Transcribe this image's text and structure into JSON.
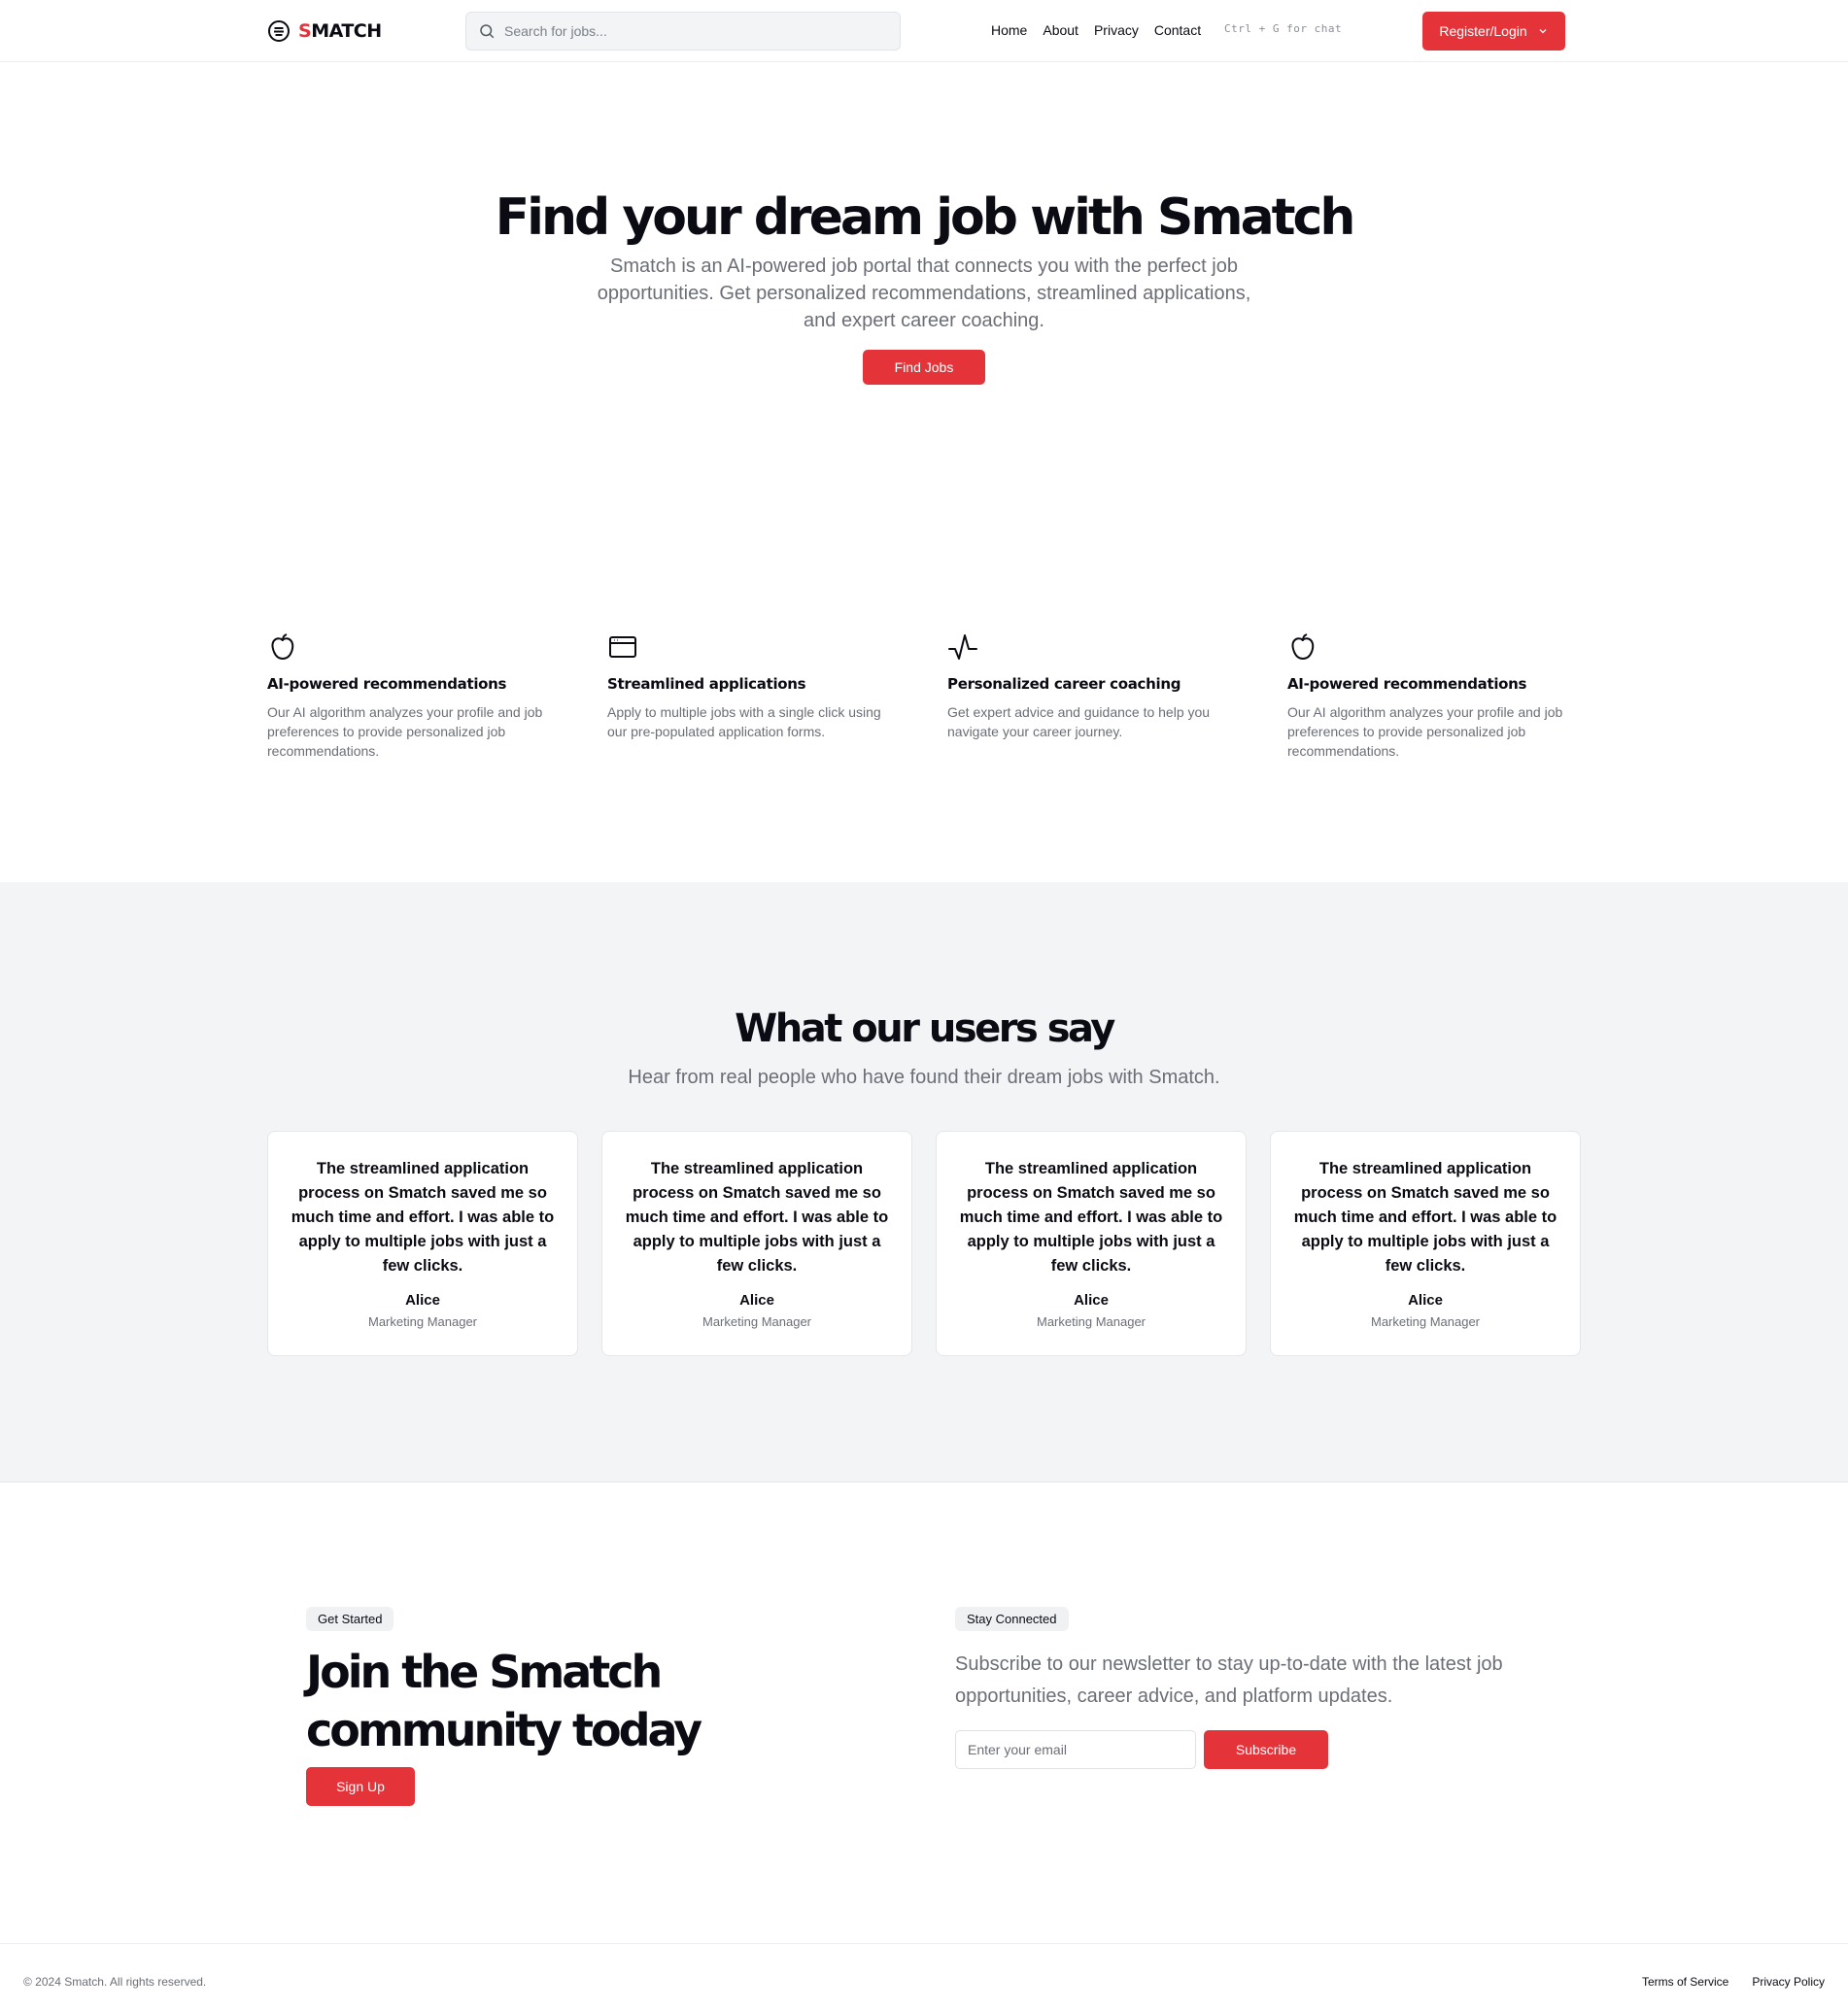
{
  "brand": {
    "first_letter": "S",
    "rest": "MATCH"
  },
  "search": {
    "placeholder": "Search for jobs..."
  },
  "nav": {
    "items": [
      "Home",
      "About",
      "Privacy",
      "Contact"
    ]
  },
  "chat_hint": "Ctrl + G for chat",
  "auth": {
    "label": "Register/Login"
  },
  "hero": {
    "title": "Find your dream job with Smatch",
    "subtitle": "Smatch is an AI-powered job portal that connects you with the perfect job opportunities. Get personalized recommendations, streamlined applications, and expert career coaching.",
    "cta": "Find Jobs"
  },
  "features": [
    {
      "icon": "apple-icon",
      "title": "AI-powered recommendations",
      "text": "Our AI algorithm analyzes your profile and job preferences to provide personalized job recommendations."
    },
    {
      "icon": "window-icon",
      "title": "Streamlined applications",
      "text": "Apply to multiple jobs with a single click using our pre-populated application forms."
    },
    {
      "icon": "activity-icon",
      "title": "Personalized career coaching",
      "text": "Get expert advice and guidance to help you navigate your career journey."
    },
    {
      "icon": "apple-icon",
      "title": "AI-powered recommendations",
      "text": "Our AI algorithm analyzes your profile and job preferences to provide personalized job recommendations."
    }
  ],
  "testimonials": {
    "title": "What our users say",
    "subtitle": "Hear from real people who have found their dream jobs with Smatch.",
    "items": [
      {
        "quote": "The streamlined application process on Smatch saved me so much time and effort. I was able to apply to multiple jobs with just a few clicks.",
        "name": "Alice",
        "role": "Marketing Manager"
      },
      {
        "quote": "The streamlined application process on Smatch saved me so much time and effort. I was able to apply to multiple jobs with just a few clicks.",
        "name": "Alice",
        "role": "Marketing Manager"
      },
      {
        "quote": "The streamlined application process on Smatch saved me so much time and effort. I was able to apply to multiple jobs with just a few clicks.",
        "name": "Alice",
        "role": "Marketing Manager"
      },
      {
        "quote": "The streamlined application process on Smatch saved me so much time and effort. I was able to apply to multiple jobs with just a few clicks.",
        "name": "Alice",
        "role": "Marketing Manager"
      }
    ]
  },
  "cta": {
    "pill": "Get Started",
    "title": "Join the Smatch community today",
    "button": "Sign Up"
  },
  "newsletter": {
    "pill": "Stay Connected",
    "text": "Subscribe to our newsletter to stay up-to-date with the latest job opportunities, career advice, and platform updates.",
    "placeholder": "Enter your email",
    "button": "Subscribe"
  },
  "footer": {
    "copyright": "© 2024 Smatch. All rights reserved.",
    "links": [
      "Terms of Service",
      "Privacy Policy"
    ]
  },
  "colors": {
    "accent": "#e5333a",
    "muted_text": "#6b6e76",
    "section_bg": "#f3f4f6"
  }
}
